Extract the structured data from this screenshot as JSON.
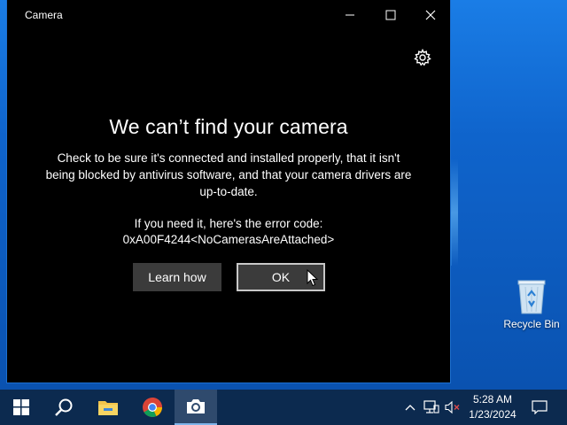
{
  "window": {
    "title": "Camera",
    "icons": {
      "minimize": "minimize-icon",
      "maximize": "maximize-icon",
      "close": "close-icon",
      "settings": "gear-icon"
    }
  },
  "error": {
    "heading": "We can’t find your camera",
    "message": "Check to be sure it's connected and installed properly, that it isn't being blocked by antivirus software, and that your camera drivers are up-to-date.",
    "code_intro": "If you need it, here's the error code:",
    "code": "0xA00F4244<NoCamerasAreAttached>"
  },
  "buttons": {
    "learn_how": "Learn how",
    "ok": "OK"
  },
  "desktop": {
    "recycle_bin_label": "Recycle Bin"
  },
  "taskbar": {
    "items": [
      "start-icon",
      "search-icon",
      "file-explorer-icon",
      "chrome-icon",
      "camera-icon"
    ],
    "active_item": "camera-icon",
    "clock_time": "5:28 AM",
    "clock_date": "1/23/2024"
  },
  "colors": {
    "window_bg": "#000000",
    "taskbar_bg": "#0c2a4f",
    "desktop_bg": "#0f64cc",
    "button_bg": "#3b3b3b"
  }
}
